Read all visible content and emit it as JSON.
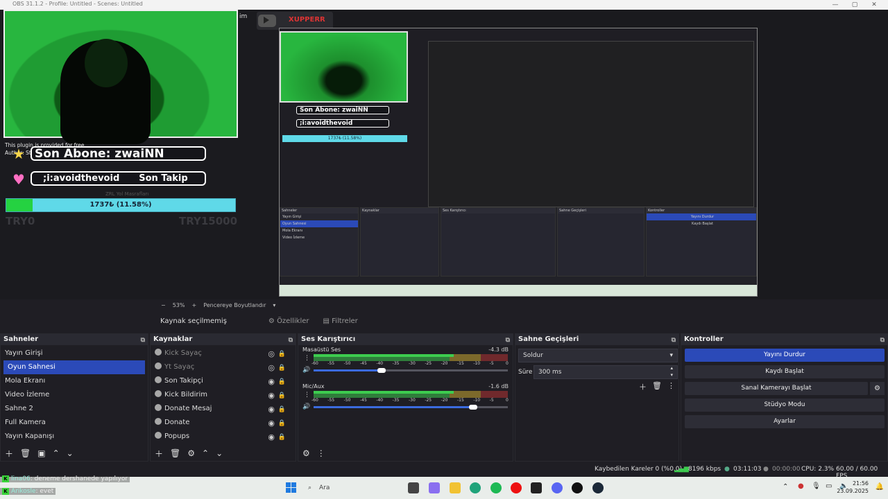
{
  "window": {
    "title": "OBS 31.1.2 - Profile: Untitled - Scenes: Untitled"
  },
  "preview": {
    "plugin_text": "This plugin is provided for free.",
    "author_text": "Author: Streamlabs",
    "last_sub": "Son Abone: zwaiNN",
    "last_follow_name": ";i:avoidthevoid",
    "last_follow_label": "Son Takip",
    "progress_text": "1737₺ (11.58%)",
    "progress_percent": 11.58,
    "goal_caption": "ZRL Yol Masrafları",
    "goal_start": "TRY0",
    "goal_end": "TRY15000",
    "channel_name": "XUPPERR",
    "cropped_title": "im"
  },
  "zoombar": {
    "zoom": "53%",
    "resize_label": "Pencereye Boyutlandır"
  },
  "source_toolbar": {
    "no_source": "Kaynak seçilmemiş",
    "properties": "Özellikler",
    "filters": "Filtreler"
  },
  "scenes": {
    "title": "Sahneler",
    "items": [
      "Yayın Girişi",
      "Oyun Sahnesi",
      "Mola Ekranı",
      "Video İzleme",
      "Sahne 2",
      "Full Kamera",
      "Yayın Kapanışı"
    ],
    "selected": 1
  },
  "sources": {
    "title": "Kaynaklar",
    "items": [
      {
        "label": "Kick Sayaç",
        "visible": false
      },
      {
        "label": "Yt Sayaç",
        "visible": false
      },
      {
        "label": "Son Takipçi",
        "visible": true
      },
      {
        "label": "Kick Bildirim",
        "visible": true
      },
      {
        "label": "Donate Mesaj",
        "visible": true
      },
      {
        "label": "Donate",
        "visible": true
      },
      {
        "label": "Popups",
        "visible": true
      }
    ]
  },
  "mixer": {
    "title": "Ses Karıştırıcı",
    "channels": [
      {
        "name": "Masaüstü Ses",
        "db": "-4.3 dB",
        "level": 0.35
      },
      {
        "name": "Mic/Aux",
        "db": "-1.6 dB",
        "level": 0.82
      }
    ],
    "scale": [
      "-60",
      "-55",
      "-50",
      "-45",
      "-40",
      "-35",
      "-30",
      "-25",
      "-20",
      "-15",
      "-10",
      "-5",
      "0"
    ]
  },
  "transitions": {
    "title": "Sahne Geçişleri",
    "type": "Soldur",
    "duration_label": "Süre",
    "duration": "300 ms"
  },
  "controls": {
    "title": "Kontroller",
    "stop_stream": "Yayını Durdur",
    "start_record": "Kaydı Başlat",
    "virtual_cam": "Sanal Kamerayı Başlat",
    "studio_mode": "Stüdyo Modu",
    "settings": "Ayarlar"
  },
  "status": {
    "dropped_frames": "Kaybedilen Kareler 0 (%0.0)",
    "bitrate": "8196 kbps",
    "stream_time": "03:11:03",
    "record_time": "00:00:00",
    "cpu": "CPU: 2.3%",
    "fps": "60.00 / 60.00 FPS"
  },
  "chat": [
    {
      "user": "lina06",
      "message": ": deneme dershanede yapılıyor"
    },
    {
      "user": "Arikosle",
      "message": ": evet"
    }
  ],
  "taskbar": {
    "search_placeholder": "Ara",
    "time": "21:56",
    "date": "23.09.2025"
  },
  "colors": {
    "accent": "#2b4ab8",
    "meter_green": "#3dcc4f",
    "meter_yellow": "#c9a832",
    "meter_red": "#b33333",
    "preview_green": "#28b63f"
  }
}
